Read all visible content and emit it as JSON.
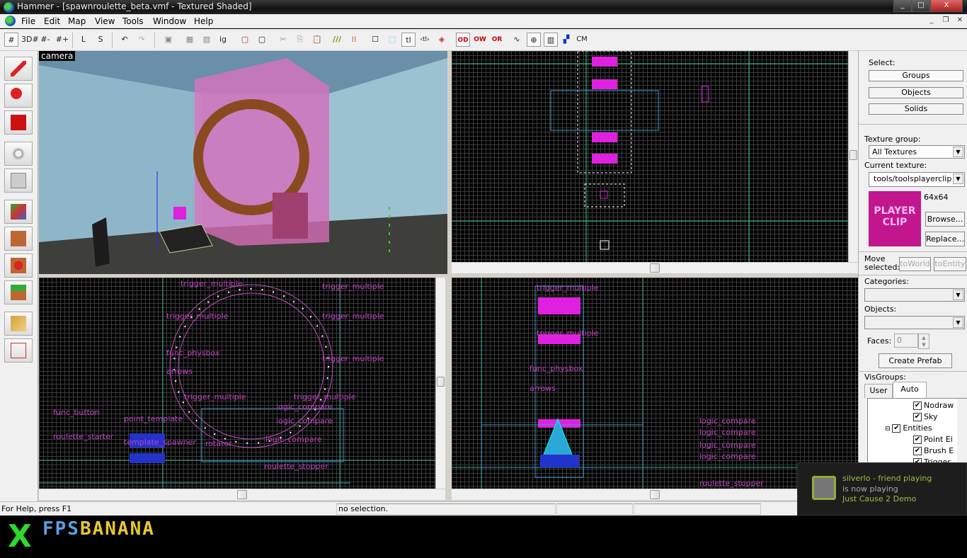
{
  "window": {
    "title": "Hammer - [spawnroulette_beta.vmf - Textured Shaded]",
    "min": "_",
    "max": "□",
    "close": "X"
  },
  "menu": [
    "File",
    "Edit",
    "Map",
    "View",
    "Tools",
    "Window",
    "Help"
  ],
  "toolbar": {
    "items": [
      "#",
      "3D#",
      "#-",
      "#+",
      "L",
      "S",
      "↶",
      "↷",
      "▣",
      "▦",
      "▧",
      "ig",
      "▢",
      "▢",
      "✂",
      "⎘",
      "📋",
      "///",
      "⁞⁞",
      "☐",
      "⬚",
      "tl",
      "‹tl›",
      "◈",
      "OD",
      "OW",
      "OR",
      "∿",
      "⊕",
      "▥",
      "▞",
      "CM"
    ]
  },
  "viewports": {
    "camera_label": "camera",
    "bottom_left_labels": [
      "trigger_multiple",
      "trigger_multiple",
      "trigger_multiple",
      "trigger_multiple",
      "func_physbox",
      "trigger_multiple",
      "arrows",
      "trigger_multiple",
      "trigger_multiple",
      "func_button",
      "roulette_starter",
      "point_template",
      "template_spawner",
      "rotator",
      "logic_compare",
      "logic_compare",
      "logic_compare",
      "roulette_stopper"
    ],
    "bottom_right_labels": [
      "trigger_multiple",
      "trigger_multiple",
      "func_physbox",
      "arrows",
      "logic_compare",
      "logic_compare",
      "logic_compare",
      "logic_compare",
      "roulette_stopper"
    ]
  },
  "right_panel": {
    "select_label": "Select:",
    "select_buttons": [
      "Groups",
      "Objects",
      "Solids"
    ],
    "texture_group_label": "Texture group:",
    "texture_group_value": "All Textures",
    "current_texture_label": "Current texture:",
    "current_texture_value": "tools/toolsplayerclip",
    "texture_size": "64x64",
    "texture_preview_text": "PLAYER CLIP",
    "browse": "Browse...",
    "replace": "Replace...",
    "move_selected": "Move selected:",
    "to_world": "toWorld",
    "to_entity": "toEntity",
    "categories_label": "Categories:",
    "objects_label": "Objects:",
    "faces_label": "Faces:",
    "faces_value": "0",
    "create_prefab": "Create Prefab",
    "visgroups_label": "VisGroups:",
    "tabs": [
      "User",
      "Auto"
    ],
    "visgroups": [
      {
        "label": "Nodraw",
        "checked": true
      },
      {
        "label": "Sky",
        "checked": true
      },
      {
        "label": "Entities",
        "checked": true
      },
      {
        "label": "Point Ei",
        "checked": true
      },
      {
        "label": "Brush E",
        "checked": true
      },
      {
        "label": "Trigger",
        "checked": true
      }
    ],
    "accent": "#c2168e"
  },
  "status": {
    "help": "For Help, press F1",
    "selection": "no selection."
  },
  "banner": {
    "logo": "FPSBANANA"
  },
  "notification": {
    "line1": "silverlo - friend playing",
    "line2": "is now playing",
    "line3": "Just Cause 2 Demo"
  }
}
